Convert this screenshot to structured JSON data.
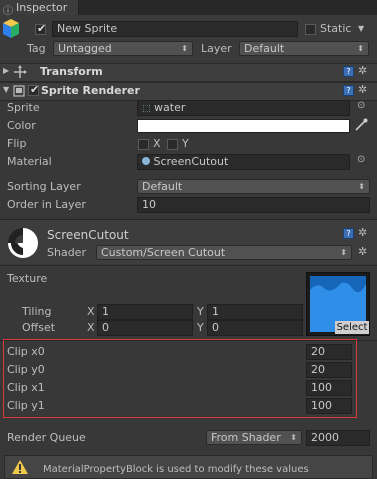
{
  "tab": {
    "title": "Inspector"
  },
  "gameobject": {
    "name": "New Sprite",
    "static_label": "Static",
    "tag_label": "Tag",
    "tag_value": "Untagged",
    "layer_label": "Layer",
    "layer_value": "Default"
  },
  "transform": {
    "title": "Transform"
  },
  "sprite_renderer": {
    "title": "Sprite Renderer",
    "sprite_label": "Sprite",
    "sprite_value": "water",
    "color_label": "Color",
    "color_value": "#ffffff",
    "flip_label": "Flip",
    "flip_x": "X",
    "flip_y": "Y",
    "material_label": "Material",
    "material_value": "ScreenCutout",
    "sorting_layer_label": "Sorting Layer",
    "sorting_layer_value": "Default",
    "order_label": "Order in Layer",
    "order_value": "10"
  },
  "material": {
    "name": "ScreenCutout",
    "shader_label": "Shader",
    "shader_value": "Custom/Screen Cutout",
    "texture_label": "Texture",
    "tiling_label": "Tiling",
    "tiling_x": "1",
    "tiling_y": "1",
    "offset_label": "Offset",
    "offset_x": "0",
    "offset_y": "0",
    "axis_x": "X",
    "axis_y": "Y",
    "select_label": "Select",
    "clip_props": [
      {
        "label": "Clip x0",
        "value": "20"
      },
      {
        "label": "Clip y0",
        "value": "20"
      },
      {
        "label": "Clip x1",
        "value": "100"
      },
      {
        "label": "Clip y1",
        "value": "100"
      }
    ],
    "render_queue_label": "Render Queue",
    "render_queue_mode": "From Shader",
    "render_queue_value": "2000",
    "warning": "MaterialPropertyBlock is used to modify these values"
  }
}
